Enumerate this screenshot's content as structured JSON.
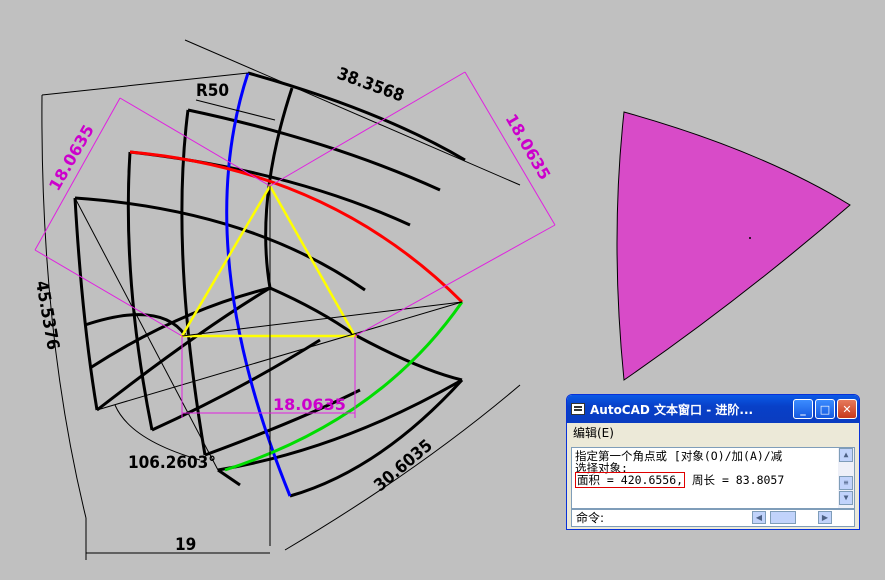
{
  "drawing": {
    "dimensions": {
      "radius": "R50",
      "arc_top": "38.3568",
      "left_aligned": "18.0635",
      "right_aligned": "18.0635",
      "left_arc": "45.5376",
      "bottom_horizontal": "18.0635",
      "angle": "106.2603°",
      "bottom_right_arc": "30.6035",
      "bottom_linear": "19"
    },
    "shape_color": "#d84bc8"
  },
  "text_window": {
    "title": "AutoCAD 文本窗口 - 进阶...",
    "minimize": "_",
    "maximize": "□",
    "close": "✕",
    "menu_edit": "编辑(E)",
    "line1": "指定第一个角点或 [对象(O)/加(A)/减",
    "line2": "选择对象:",
    "area_text": "面积 = 420.6556,",
    "perimeter_text": "周长 = 83.8057",
    "command_prompt": "命令:"
  }
}
